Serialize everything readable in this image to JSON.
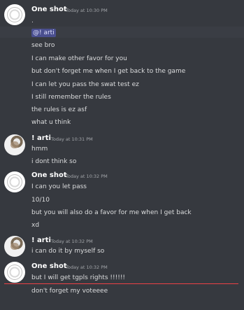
{
  "messages": [
    {
      "author": "One shot",
      "timestamp": "Today at 10:30 PM",
      "avatar_icon": "discord-default-avatar-icon",
      "lines": [
        ".",
        "@! arti",
        "see bro",
        "I can make other favor for you",
        "but don't forget me when I get back to the game",
        "I can let you pass the swat test ez",
        "I still remember the rules",
        "the rules is ez asf",
        "what u think"
      ]
    },
    {
      "author": "! arti",
      "timestamp": "Today at 10:31 PM",
      "avatar_icon": "photo-avatar-icon",
      "lines": [
        "hmm",
        "i dont think so"
      ]
    },
    {
      "author": "One shot",
      "timestamp": "Today at 10:32 PM",
      "avatar_icon": "discord-default-avatar-icon",
      "lines": [
        "I can you let pass",
        "10/10",
        "but you will also do a favor for me when I get back",
        "xd"
      ]
    },
    {
      "author": "! arti",
      "timestamp": "Today at 10:32 PM",
      "avatar_icon": "photo-avatar-icon",
      "lines": [
        "i can do it by myself so"
      ]
    },
    {
      "author": "One shot",
      "timestamp": "Today at 10:32 PM",
      "avatar_icon": "discord-default-avatar-icon",
      "lines": [
        "but I will get tgpls rights !!!!!!",
        "don't forget my voteeee"
      ]
    }
  ],
  "colors": {
    "background": "#36393f",
    "text": "#dcddde",
    "username": "#ffffff",
    "timestamp": "#a3a6aa",
    "mention_bg": "#4a4f8f",
    "new_divider": "#ed4245"
  }
}
